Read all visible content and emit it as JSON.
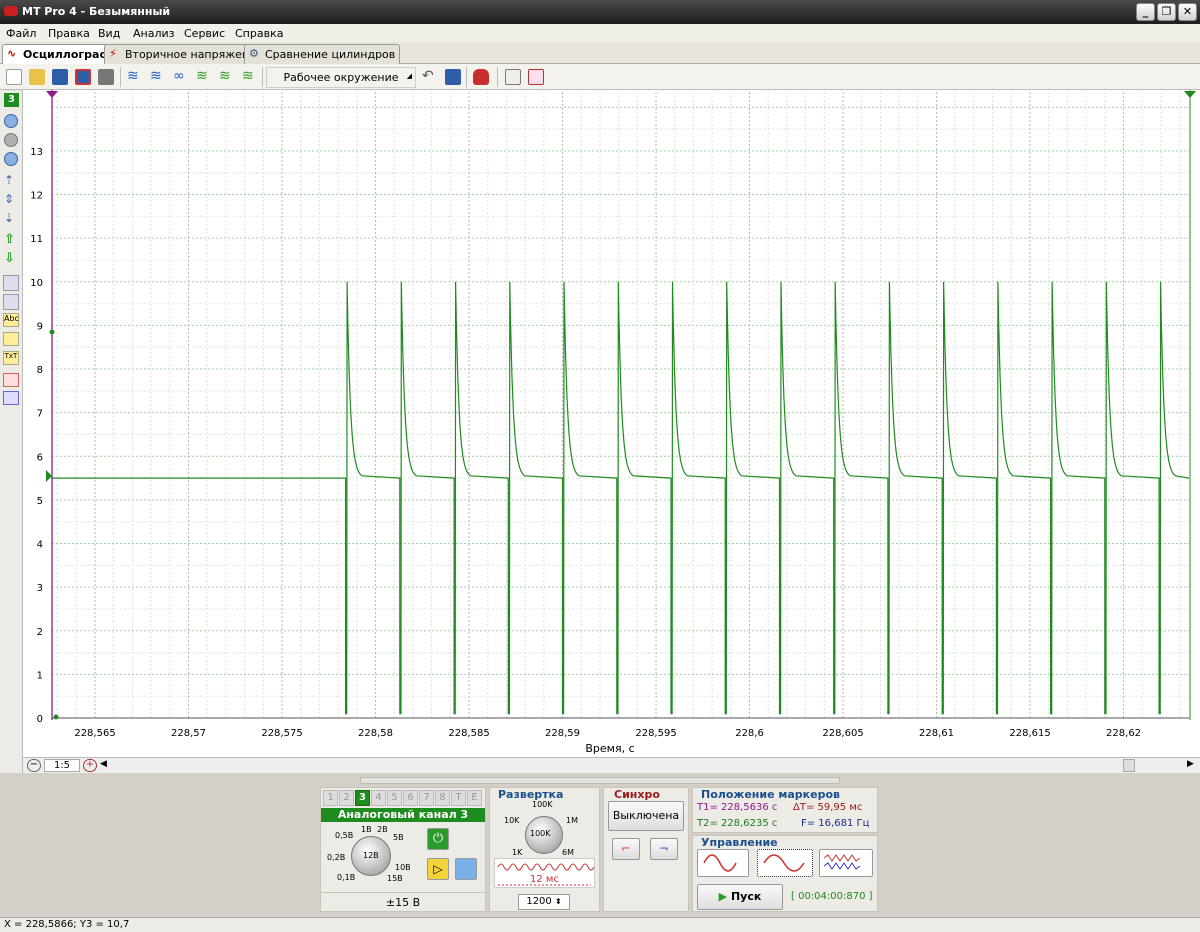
{
  "window": {
    "title": "MT Pro 4 - Безымянный",
    "minimize": "_",
    "restore": "❐",
    "close": "✕"
  },
  "menu": [
    "Файл",
    "Правка",
    "Вид",
    "Анализ",
    "Сервис",
    "Справка"
  ],
  "tabs": [
    {
      "label": "Осциллограф",
      "icon": "oscilloscope-icon",
      "active": true
    },
    {
      "label": "Вторичное напряжение",
      "icon": "ignition-icon"
    },
    {
      "label": "Сравнение цилиндров",
      "icon": "cylinders-icon"
    }
  ],
  "toolbar": {
    "environment": "Рабочее окружение"
  },
  "left_tools": {
    "channel_badge": "3"
  },
  "chart_data": {
    "type": "line",
    "xlabel": "Время, с",
    "ylabel": "",
    "xlim": [
      228.5627,
      228.6235
    ],
    "ylim": [
      0,
      14
    ],
    "x_ticks": [
      "228,565",
      "228,57",
      "228,575",
      "228,58",
      "228,585",
      "228,59",
      "228,595",
      "228,6",
      "228,605",
      "228,61",
      "228,615",
      "228,62"
    ],
    "y_ticks": [
      "0",
      "1",
      "2",
      "3",
      "4",
      "5",
      "6",
      "7",
      "8",
      "9",
      "10",
      "11",
      "12",
      "13"
    ],
    "grid": true,
    "series": [
      {
        "color": "#208a20",
        "baseline": 5.5,
        "first_pulse_x": 228.5784,
        "pulse_period": 0.0029,
        "pulse_count": 16,
        "pulse_min": 0.1,
        "pulse_peak": 10.0,
        "decay_tau": 0.00018
      }
    ]
  },
  "scroll": {
    "zoom": "1:5"
  },
  "channel_panel": {
    "tabs": [
      "1",
      "2",
      "3",
      "4",
      "5",
      "6",
      "7",
      "8",
      "T",
      "E"
    ],
    "active_tab": "3",
    "title": "Аналоговый канал 3",
    "range_labels": [
      "0,5В",
      "1В",
      "2В",
      "5В",
      "0,2В",
      "12В",
      "10В",
      "0,1В",
      "15В"
    ],
    "range": "±15 В"
  },
  "sweep_panel": {
    "title": "Развертка",
    "labels": [
      "100K",
      "10K",
      "1M",
      "100K",
      "1K",
      "6M"
    ],
    "time": "12 мс",
    "points": "1200"
  },
  "sync_panel": {
    "title": "Синхро",
    "value": "Выключена"
  },
  "markers_panel": {
    "title": "Положение маркеров",
    "t1": "T1= 228,5636 с",
    "t2": "T2= 228,6235 с",
    "dt": "ΔT= 59,95 мс",
    "f": "F= 16,681 Гц"
  },
  "control_panel": {
    "title": "Управление",
    "start": "Пуск",
    "timer": "[ 00:04:00:870 ]"
  },
  "status": {
    "text": "X = 228,5866; Y3 = 10,7"
  },
  "colors": {
    "trace": "#208a20",
    "marker1": "#8b1a8b",
    "accent": "#1e8c1e"
  }
}
